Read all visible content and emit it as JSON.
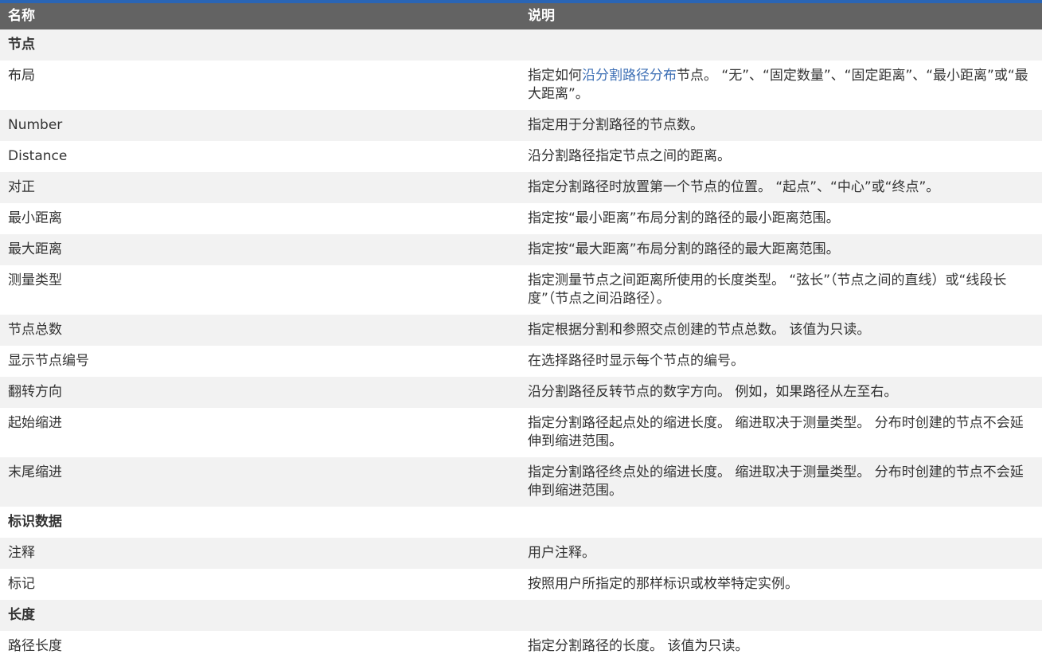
{
  "header": {
    "col_name": "名称",
    "col_desc": "说明"
  },
  "rows": [
    {
      "type": "section",
      "name": "节点"
    },
    {
      "type": "row",
      "name": "布局",
      "desc_pre": "指定如何",
      "desc_link": "沿分割路径分布",
      "desc_post": "节点。 “无”、“固定数量”、“固定距离”、“最小距离”或“最大距离”。"
    },
    {
      "type": "row",
      "name": "Number",
      "desc": "指定用于分割路径的节点数。"
    },
    {
      "type": "row",
      "name": "Distance",
      "desc": "沿分割路径指定节点之间的距离。"
    },
    {
      "type": "row",
      "name": "对正",
      "desc": "指定分割路径时放置第一个节点的位置。 “起点”、“中心”或“终点”。"
    },
    {
      "type": "row",
      "name": "最小距离",
      "desc": "指定按“最小距离”布局分割的路径的最小距离范围。"
    },
    {
      "type": "row",
      "name": "最大距离",
      "desc": "指定按“最大距离”布局分割的路径的最大距离范围。"
    },
    {
      "type": "row",
      "name": "测量类型",
      "desc": "指定测量节点之间距离所使用的长度类型。 “弦长”（节点之间的直线）或“线段长度”（节点之间沿路径）。"
    },
    {
      "type": "row",
      "name": "节点总数",
      "desc": "指定根据分割和参照交点创建的节点总数。 该值为只读。"
    },
    {
      "type": "row",
      "name": "显示节点编号",
      "desc": "在选择路径时显示每个节点的编号。"
    },
    {
      "type": "row",
      "name": "翻转方向",
      "desc": "沿分割路径反转节点的数字方向。 例如，如果路径从左至右。"
    },
    {
      "type": "row",
      "name": "起始缩进",
      "desc": "指定分割路径起点处的缩进长度。 缩进取决于测量类型。 分布时创建的节点不会延伸到缩进范围。"
    },
    {
      "type": "row",
      "name": "末尾缩进",
      "desc": "指定分割路径终点处的缩进长度。 缩进取决于测量类型。 分布时创建的节点不会延伸到缩进范围。"
    },
    {
      "type": "section",
      "name": "标识数据"
    },
    {
      "type": "row",
      "name": "注释",
      "desc": "用户注释。"
    },
    {
      "type": "row",
      "name": "标记",
      "desc": "按照用户所指定的那样标识或枚举特定实例。"
    },
    {
      "type": "section",
      "name": "长度"
    },
    {
      "type": "row",
      "name": "路径长度",
      "desc": "指定分割路径的长度。 该值为只读。"
    }
  ]
}
